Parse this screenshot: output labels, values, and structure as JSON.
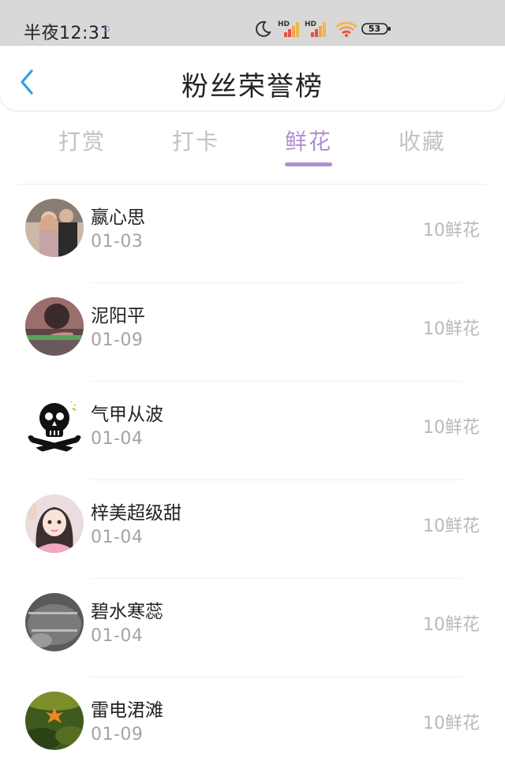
{
  "status_bar": {
    "time": "半夜12:31",
    "network_label_1": "HD",
    "network_label_2": "HD",
    "battery_level": "53"
  },
  "header": {
    "title": "粉丝荣誉榜",
    "back_icon": "chevron-left-icon"
  },
  "tabs": [
    {
      "label": "打赏",
      "active": false
    },
    {
      "label": "打卡",
      "active": false
    },
    {
      "label": "鲜花",
      "active": true
    },
    {
      "label": "收藏",
      "active": false
    }
  ],
  "accent_color": "#b08fd3",
  "fans": [
    {
      "name": "嬴心思",
      "date": "01-03",
      "amount": "10鲜花"
    },
    {
      "name": "泥阳平",
      "date": "01-09",
      "amount": "10鲜花"
    },
    {
      "name": "气甲从波",
      "date": "01-04",
      "amount": "10鲜花"
    },
    {
      "name": "梓美超级甜",
      "date": "01-04",
      "amount": "10鲜花"
    },
    {
      "name": "碧水寒蕊",
      "date": "01-04",
      "amount": "10鲜花"
    },
    {
      "name": "雷电涒滩",
      "date": "01-09",
      "amount": "10鲜花"
    }
  ]
}
